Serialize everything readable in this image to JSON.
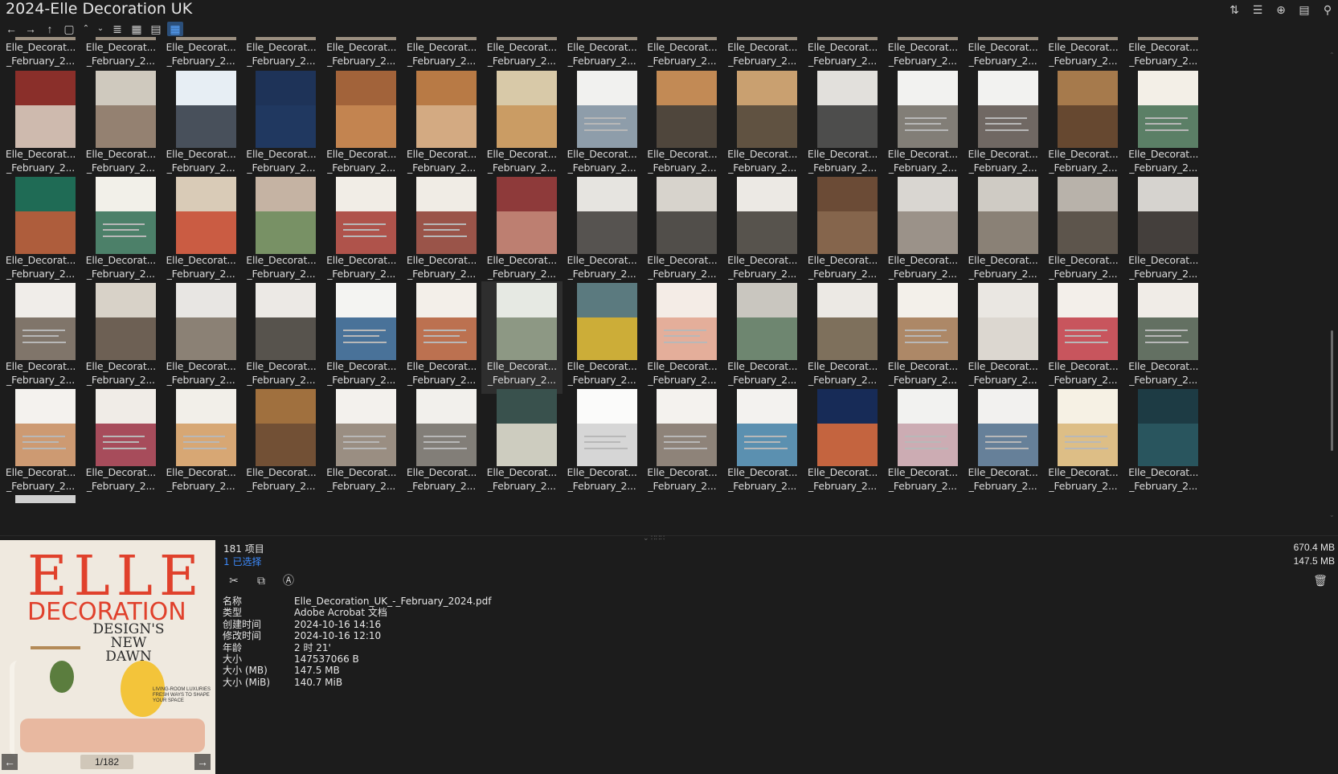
{
  "window": {
    "title": "2024-Elle Decoration UK",
    "top_icons": [
      "sort-icon",
      "list-view-icon",
      "add-circle-icon",
      "clipboard-icon",
      "pin-icon"
    ]
  },
  "toolbar": {
    "icons": [
      "back-icon",
      "forward-icon",
      "up-icon",
      "copy-path-icon",
      "collapse-icon",
      "expand-icon",
      "details-view-icon",
      "tiles-view-icon",
      "content-view-icon",
      "thumbnails-view-icon"
    ]
  },
  "grid": {
    "label_line1": "Elle_Decorat...",
    "label_line2": "_February_2...",
    "selected_index": 36
  },
  "status": {
    "item_count": "181 项目",
    "selected_count": "1 已选择",
    "total_size": "670.4 MB",
    "selected_size": "147.5 MB"
  },
  "actions": {
    "cut": "scissors-icon",
    "copy": "copy-icon",
    "rename": "rename-icon",
    "delete": "trash-icon"
  },
  "properties": [
    {
      "key": "名称",
      "value": "Elle_Decoration_UK_-_February_2024.pdf"
    },
    {
      "key": "类型",
      "value": "Adobe Acrobat 文档"
    },
    {
      "key": "创建时间",
      "value": "2024-10-16  14:16"
    },
    {
      "key": "修改时间",
      "value": "2024-10-16  12:10"
    },
    {
      "key": "年龄",
      "value": "2 时 21'"
    },
    {
      "key": "大小",
      "value": "147537066 B"
    },
    {
      "key": "大小 (MB)",
      "value": "147.5 MB"
    },
    {
      "key": "大小 (MiB)",
      "value": "140.7 MiB"
    }
  ],
  "preview": {
    "brand": "ELLE",
    "brand2": "DECORATION",
    "headline": "DESIGN'S NEW DAWN",
    "subline": "LIVING-ROOM LUXURIES FRESH WAYS TO SHAPE YOUR SPACE",
    "page_indicator": "1/182"
  }
}
